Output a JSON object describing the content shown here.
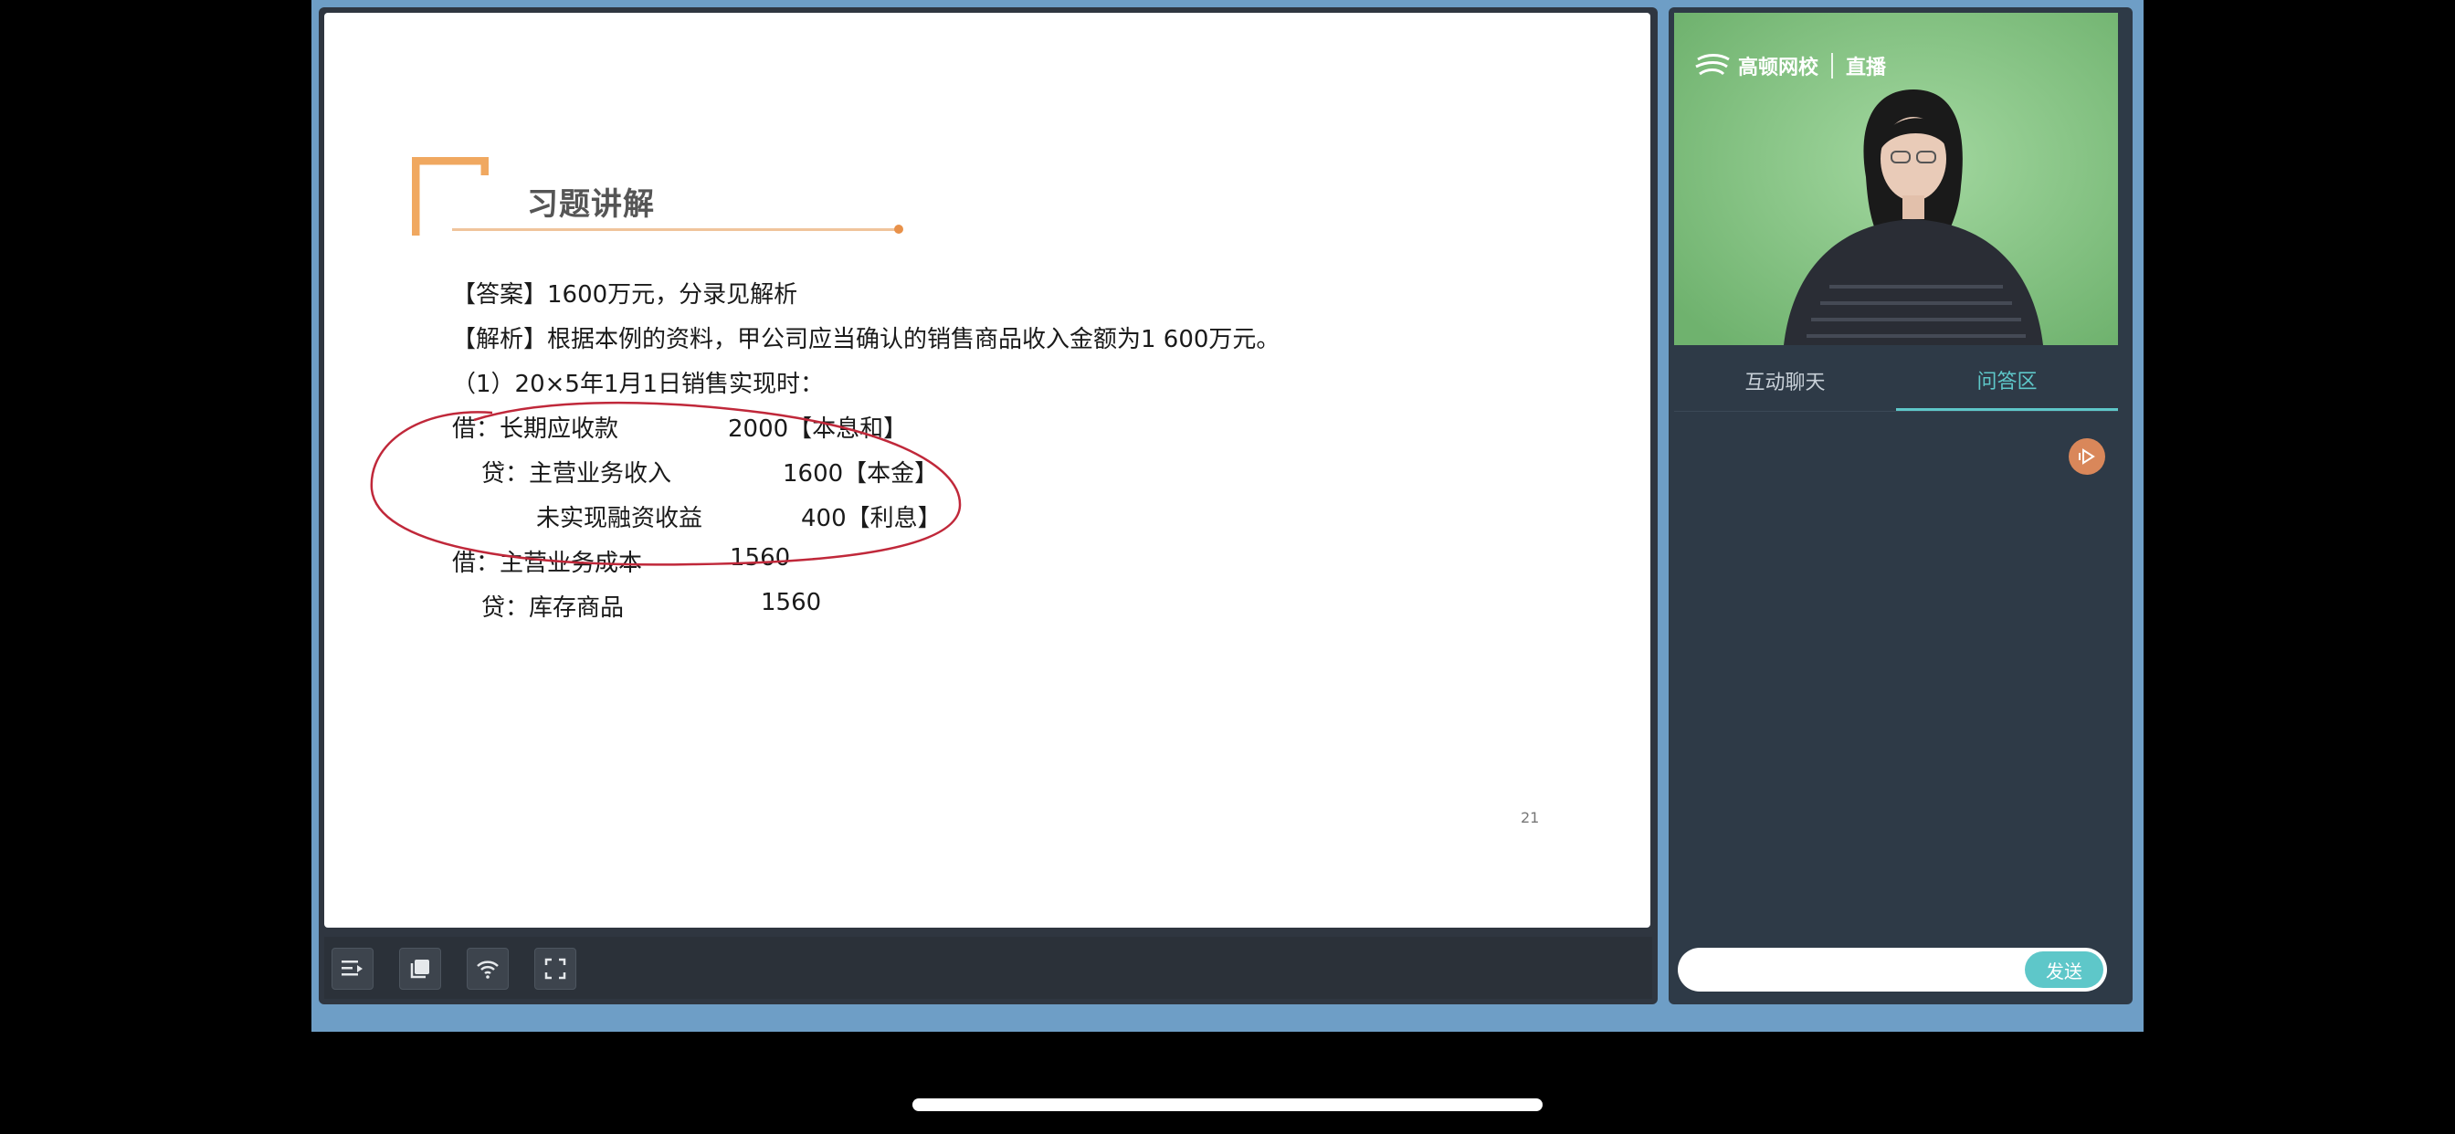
{
  "slide": {
    "title": "习题讲解",
    "lines": [
      "【答案】1600万元，分录见解析",
      "【解析】根据本例的资料，甲公司应当确认的销售商品收入金额为1 600万元。",
      "（1）20×5年1月1日销售实现时："
    ],
    "entries": [
      {
        "account": "借：长期应收款",
        "amount": "2000【本息和】"
      },
      {
        "account": "贷：主营业务收入",
        "amount": "1600【本金】"
      },
      {
        "account": "未实现融资收益",
        "amount": "400【利息】"
      },
      {
        "account": "借：主营业务成本",
        "amount": "1560"
      },
      {
        "account": "贷：库存商品",
        "amount": "1560"
      }
    ],
    "page_number": "21"
  },
  "video": {
    "logo_name": "高顿网校",
    "logo_sub": "直播"
  },
  "tabs": {
    "chat": "互动聊天",
    "qa": "问答区"
  },
  "input": {
    "send_label": "发送",
    "placeholder": ""
  },
  "icons": {
    "toolbar": [
      "catalog-icon",
      "copy-layers-icon",
      "signal-icon",
      "fullscreen-icon"
    ],
    "play": "play-badge-icon"
  },
  "colors": {
    "accent": "#5ec7c9",
    "bracket": "#f0a860",
    "annotation": "#c0283a"
  }
}
